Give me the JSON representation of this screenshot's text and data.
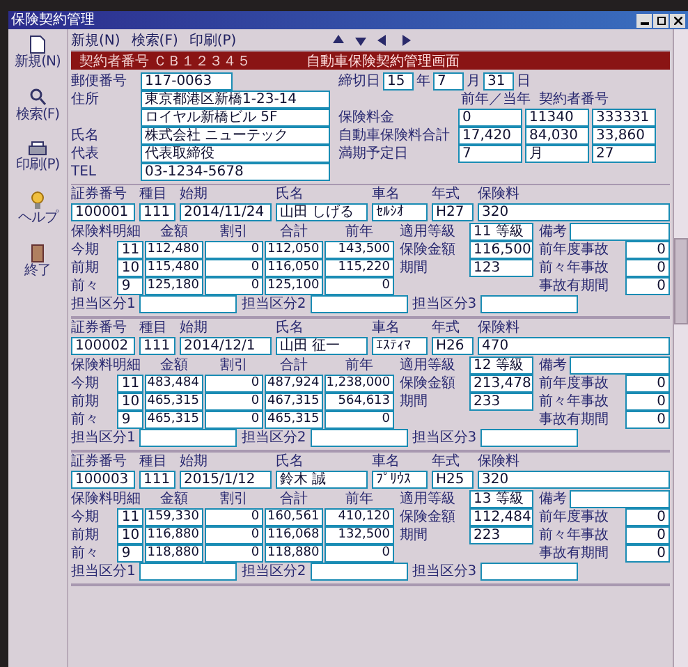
{
  "window": {
    "title": "保険契約管理"
  },
  "sidebar": {
    "items": [
      {
        "label": "新規(N)"
      },
      {
        "label": "検索(F)"
      },
      {
        "label": "印刷(P)"
      },
      {
        "label": "ヘルプ"
      },
      {
        "label": "終了"
      }
    ]
  },
  "menu": [
    "新規(N)",
    "検索(F)",
    "印刷(P)"
  ],
  "header": {
    "left": "契約者番号 ＣＢ１２３４５",
    "title": "自動車保険契約管理画面"
  },
  "customer": {
    "fields": [
      {
        "label": "郵便番号",
        "value": "117-0063"
      },
      {
        "label": "住所",
        "value": "東京都港区新橋1-23-14"
      },
      {
        "value": "ロイヤル新橋ビル 5F"
      },
      {
        "label": "氏名",
        "value": "株式会社 ニューテック"
      },
      {
        "label": "代表",
        "value": "代表取締役"
      },
      {
        "label": "TEL",
        "value": "03-1234-5678"
      }
    ],
    "closing": {
      "label": "締切日",
      "year": "15",
      "year_unit": "年",
      "month": "7",
      "month_unit": "月",
      "day": "31",
      "day_unit": "日"
    },
    "columns": [
      "前年／当年",
      "契約者番号"
    ],
    "rows": [
      {
        "label": "保険料金",
        "values": [
          "0",
          "11340",
          "333331"
        ]
      },
      {
        "label": "自動車保険料合計",
        "values": [
          "17,420",
          "84,030",
          "33,860"
        ]
      },
      {
        "label": "満期予定日",
        "values": [
          "7",
          "月",
          "27"
        ]
      }
    ]
  },
  "blocks": [
    {
      "head": [
        {
          "label": "証券番号",
          "value": "100001"
        },
        {
          "label": "種目",
          "value": "111"
        },
        {
          "label": "始期",
          "value": "2014/11/24"
        },
        {
          "label": "氏名",
          "value": "山田 しげる"
        },
        {
          "label": "車名",
          "value": "ｾﾙｼｵ"
        },
        {
          "label": "年式",
          "value": "H27"
        },
        {
          "label": "保険料",
          "value": "320"
        }
      ],
      "table_title": "保険料明細",
      "columns": [
        "金額",
        "割引",
        "合計",
        "前年"
      ],
      "rows": [
        {
          "label": "今期",
          "month": "11",
          "values": [
            "112,480",
            "0",
            "112,050",
            "143,500"
          ]
        },
        {
          "label": "前期",
          "month": "10",
          "values": [
            "115,480",
            "0",
            "116,050",
            "115,220"
          ]
        },
        {
          "label": "前々",
          "month": "9",
          "values": [
            "125,180",
            "0",
            "125,100",
            "0"
          ]
        }
      ],
      "info": [
        {
          "label": "適用等級",
          "value": "11 等級"
        },
        {
          "label": "保険金額",
          "value": "116,500"
        },
        {
          "label": "期間",
          "value": "123"
        }
      ],
      "remarks_label": "備考",
      "counts": [
        {
          "label": "前年度事故",
          "value": "0"
        },
        {
          "label": "前々年事故",
          "value": "0"
        },
        {
          "label": "事故有期間",
          "value": "0"
        }
      ],
      "bottom": [
        "担当区分1",
        "担当区分2",
        "担当区分3"
      ]
    },
    {
      "head": [
        {
          "label": "証券番号",
          "value": "100002"
        },
        {
          "label": "種目",
          "value": "111"
        },
        {
          "label": "始期",
          "value": "2014/12/1"
        },
        {
          "label": "氏名",
          "value": "山田 征一"
        },
        {
          "label": "車名",
          "value": "ｴｽﾃｨﾏ"
        },
        {
          "label": "年式",
          "value": "H26"
        },
        {
          "label": "保険料",
          "value": "470"
        }
      ],
      "table_title": "保険料明細",
      "columns": [
        "金額",
        "割引",
        "合計",
        "前年"
      ],
      "rows": [
        {
          "label": "今期",
          "month": "11",
          "values": [
            "483,484",
            "0",
            "487,924",
            "1,238,000"
          ]
        },
        {
          "label": "前期",
          "month": "10",
          "values": [
            "465,315",
            "0",
            "467,315",
            "564,613"
          ]
        },
        {
          "label": "前々",
          "month": "9",
          "values": [
            "465,315",
            "0",
            "465,315",
            "0"
          ]
        }
      ],
      "info": [
        {
          "label": "適用等級",
          "value": "12 等級"
        },
        {
          "label": "保険金額",
          "value": "213,478"
        },
        {
          "label": "期間",
          "value": "233"
        }
      ],
      "remarks_label": "備考",
      "counts": [
        {
          "label": "前年度事故",
          "value": "0"
        },
        {
          "label": "前々年事故",
          "value": "0"
        },
        {
          "label": "事故有期間",
          "value": "0"
        }
      ],
      "bottom": [
        "担当区分1",
        "担当区分2",
        "担当区分3"
      ]
    },
    {
      "head": [
        {
          "label": "証券番号",
          "value": "100003"
        },
        {
          "label": "種目",
          "value": "111"
        },
        {
          "label": "始期",
          "value": "2015/1/12"
        },
        {
          "label": "氏名",
          "value": "鈴木 誠"
        },
        {
          "label": "車名",
          "value": "ﾌﾟﾘｳｽ"
        },
        {
          "label": "年式",
          "value": "H25"
        },
        {
          "label": "保険料",
          "value": "320"
        }
      ],
      "table_title": "保険料明細",
      "columns": [
        "金額",
        "割引",
        "合計",
        "前年"
      ],
      "rows": [
        {
          "label": "今期",
          "month": "11",
          "values": [
            "159,330",
            "0",
            "160,561",
            "410,120"
          ]
        },
        {
          "label": "前期",
          "month": "10",
          "values": [
            "116,880",
            "0",
            "116,068",
            "132,500"
          ]
        },
        {
          "label": "前々",
          "month": "9",
          "values": [
            "118,880",
            "0",
            "118,880",
            "0"
          ]
        }
      ],
      "info": [
        {
          "label": "適用等級",
          "value": "13 等級"
        },
        {
          "label": "保険金額",
          "value": "112,484"
        },
        {
          "label": "期間",
          "value": "223"
        }
      ],
      "remarks_label": "備考",
      "counts": [
        {
          "label": "前年度事故",
          "value": "0"
        },
        {
          "label": "前々年事故",
          "value": "0"
        },
        {
          "label": "事故有期間",
          "value": "0"
        }
      ],
      "bottom": [
        "担当区分1",
        "担当区分2",
        "担当区分3"
      ]
    }
  ]
}
